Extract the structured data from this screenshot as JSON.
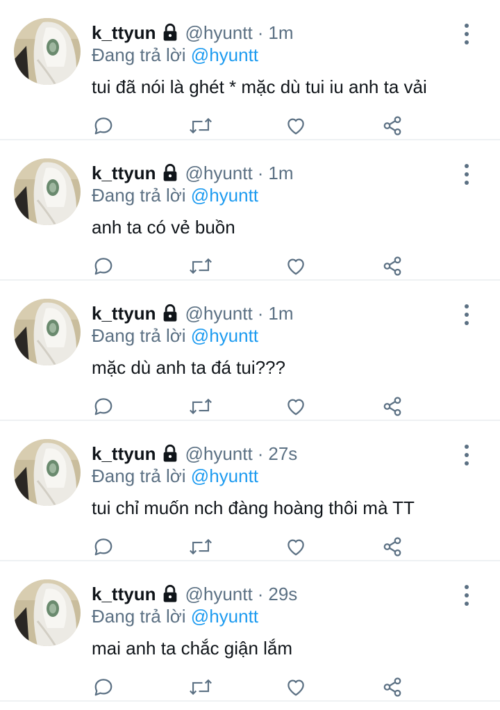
{
  "colors": {
    "text": "#0f1419",
    "secondary": "#5b7083",
    "accent": "#1d9bf0",
    "divider": "#eef1f3"
  },
  "icons": {
    "reply": "reply-icon",
    "retweet": "retweet-icon",
    "like": "like-icon",
    "share": "share-icon",
    "more": "more-icon",
    "lock": "lock-icon"
  },
  "tweets": [
    {
      "name": "k_ttyun",
      "handle": "@hyuntt",
      "separator": "·",
      "time": "1m",
      "reply_prefix": "Đang trả lời",
      "reply_to": "@hyuntt",
      "text": "tui đã nói là ghét * mặc dù tui iu anh ta vải"
    },
    {
      "name": "k_ttyun",
      "handle": "@hyuntt",
      "separator": "·",
      "time": "1m",
      "reply_prefix": "Đang trả lời",
      "reply_to": "@hyuntt",
      "text": "anh ta có vẻ buồn"
    },
    {
      "name": "k_ttyun",
      "handle": "@hyuntt",
      "separator": "·",
      "time": "1m",
      "reply_prefix": "Đang trả lời",
      "reply_to": "@hyuntt",
      "text": "mặc dù anh ta đá tui???"
    },
    {
      "name": "k_ttyun",
      "handle": "@hyuntt",
      "separator": "·",
      "time": "27s",
      "reply_prefix": "Đang trả lời",
      "reply_to": "@hyuntt",
      "text": "tui chỉ muốn nch đàng hoàng thôi mà TT"
    },
    {
      "name": "k_ttyun",
      "handle": "@hyuntt",
      "separator": "·",
      "time": "29s",
      "reply_prefix": "Đang trả lời",
      "reply_to": "@hyuntt",
      "text": "mai anh ta chắc giận lắm"
    }
  ]
}
